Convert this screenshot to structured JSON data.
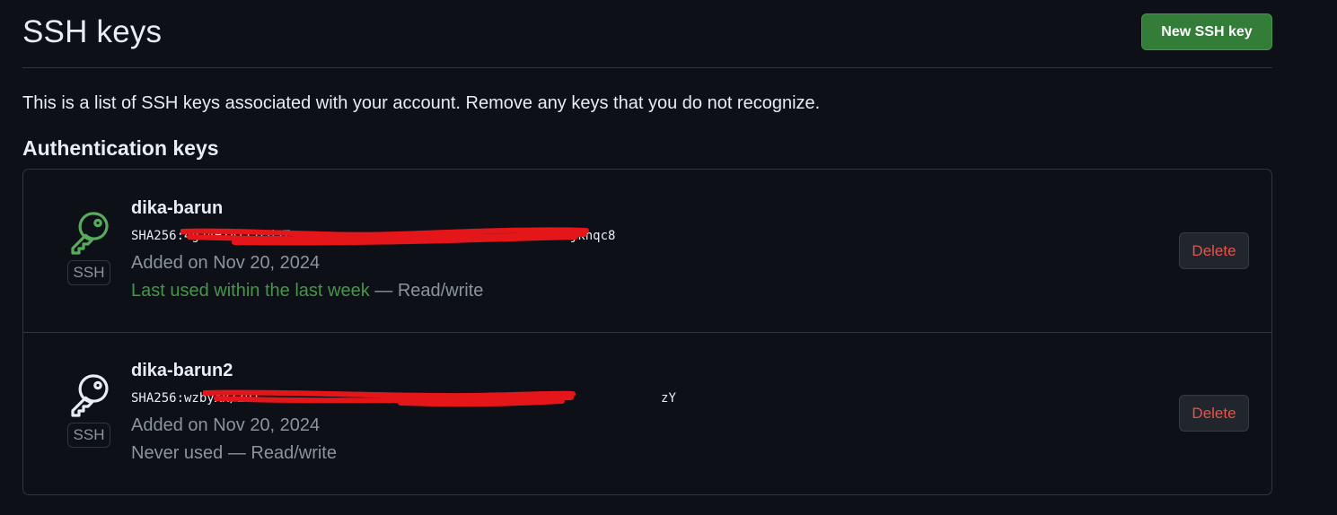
{
  "header": {
    "title": "SSH keys",
    "new_key_label": "New SSH key"
  },
  "description": "This is a list of SSH keys associated with your account. Remove any keys that you do not recognize.",
  "section_title": "Authentication keys",
  "keys": [
    {
      "name": "dika-barun",
      "fingerprint": "SHA256:4gJ4H1ATI7Fd5T                                    sjknqc8",
      "badge": "SSH",
      "added": "Added on Nov 20, 2024",
      "usage_recent": "Last used within the last week",
      "usage_rest": " — Read/write",
      "delete_label": "Delete",
      "icon": "key-icon",
      "icon_color": "#57ab5a"
    },
    {
      "name": "dika-barun2",
      "fingerprint": "SHA256:wzbyXx/Zu1                                                     zY",
      "badge": "SSH",
      "added": "Added on Nov 20, 2024",
      "usage_recent": "",
      "usage_rest": "Never used — Read/write",
      "delete_label": "Delete",
      "icon": "key-icon",
      "icon_color": "#e6edf3"
    }
  ],
  "colors": {
    "background": "#0d1117",
    "border": "#30363d",
    "primary_button": "#347d39",
    "danger_text": "#e5534b",
    "success_text": "#46954a",
    "muted_text": "#8b949e",
    "redaction": "#e5161a"
  }
}
